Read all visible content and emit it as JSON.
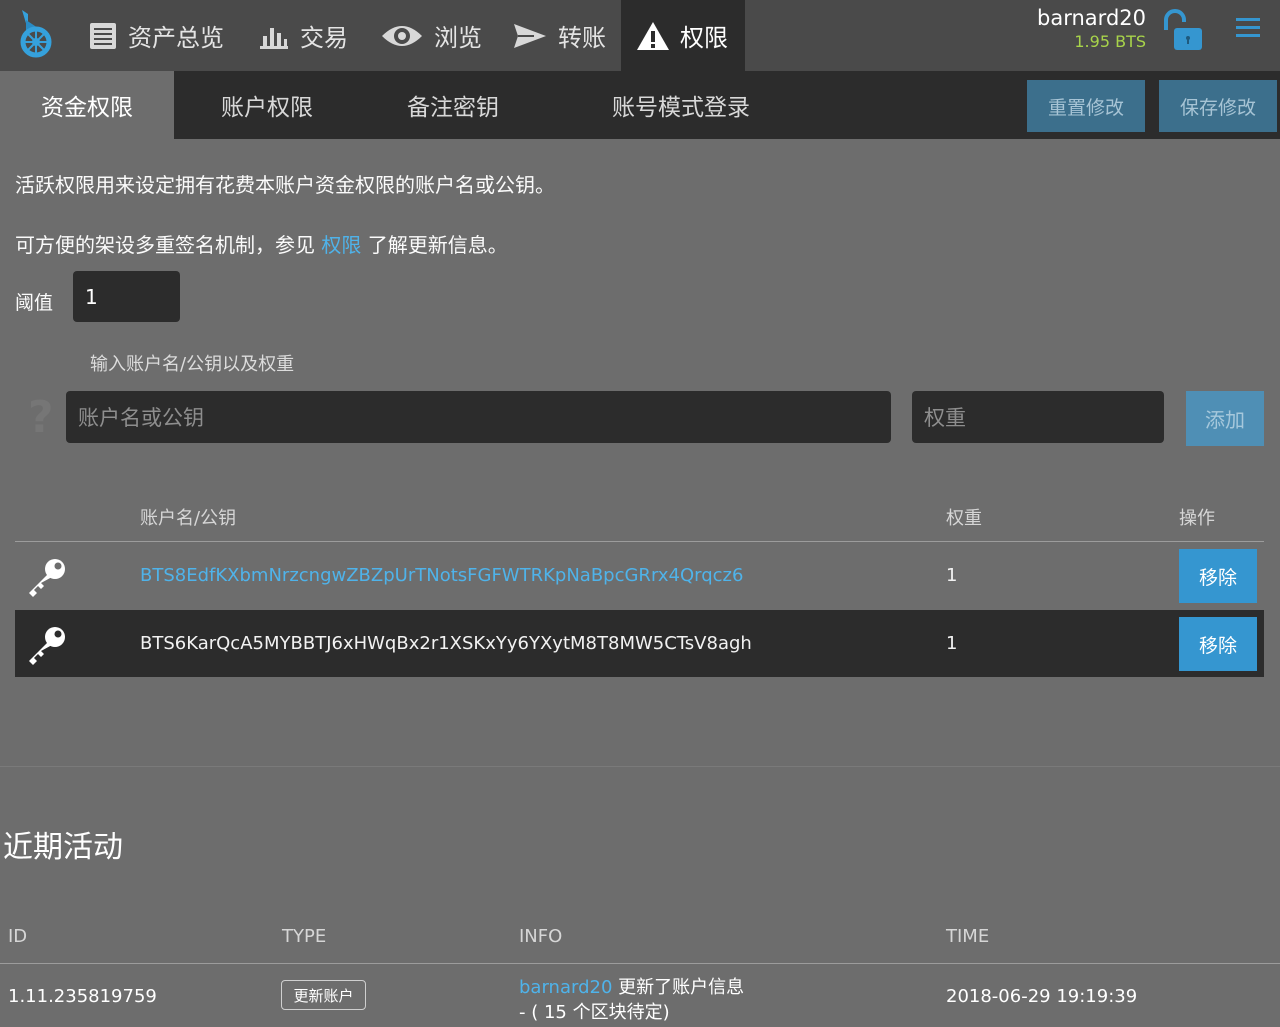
{
  "header": {
    "nav": [
      {
        "label": "资产总览",
        "icon": "dashboard-list-icon"
      },
      {
        "label": "交易",
        "icon": "bar-chart-icon"
      },
      {
        "label": "浏览",
        "icon": "eye-icon"
      },
      {
        "label": "转账",
        "icon": "send-arrow-icon"
      },
      {
        "label": "权限",
        "icon": "warning-icon"
      }
    ],
    "account_name": "barnard20",
    "balance": "1.95 BTS"
  },
  "tabs": [
    "资金权限",
    "账户权限",
    "备注密钥",
    "账号模式登录"
  ],
  "toolbar": {
    "reset_label": "重置修改",
    "save_label": "保存修改"
  },
  "intro": {
    "line1": "活跃权限用来设定拥有花费本账户资金权限的账户名或公钥。",
    "line2_before": "可方便的架设多重签名机制，参见 ",
    "line2_link": "权限",
    "line2_after": " 了解更新信息。"
  },
  "threshold": {
    "label": "阈值",
    "value": "1"
  },
  "add_form": {
    "label": "输入账户名/公钥以及权重",
    "key_placeholder": "账户名或公钥",
    "weight_placeholder": "权重",
    "add_label": "添加"
  },
  "table": {
    "headers": {
      "key": "账户名/公钥",
      "weight": "权重",
      "action": "操作"
    },
    "rows": [
      {
        "key": "BTS8EdfKXbmNrzcngwZBZpUrTNotsFGFWTRKpNaBpcGRrx4Qrqcz6",
        "weight": "1",
        "action": "移除"
      },
      {
        "key": "BTS6KarQcA5MYBBTJ6xHWqBx2r1XSKxYy6YXytM8T8MW5CTsV8agh",
        "weight": "1",
        "action": "移除"
      }
    ]
  },
  "recent": {
    "title": "近期活动",
    "headers": {
      "id": "ID",
      "type": "TYPE",
      "info": "INFO",
      "time": "TIME"
    },
    "rows": [
      {
        "id": "1.11.235819759",
        "type": "更新账户",
        "info_account": "barnard20",
        "info_text": " 更新了账户信息",
        "info_pending": "- ( 15 个区块待定)",
        "time": "2018-06-29 19:19:39"
      }
    ]
  },
  "colors": {
    "link": "#4fb3ea",
    "balance": "#a8d44a",
    "button": "#3596d0"
  }
}
